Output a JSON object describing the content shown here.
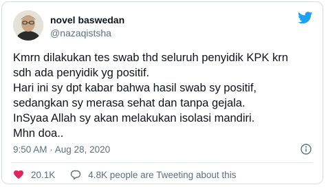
{
  "tweet": {
    "display_name": "novel baswedan",
    "handle": "@nazaqistsha",
    "lines": [
      "Kmrn dilakukan tes swab thd seluruh penyidik KPK krn",
      "sdh ada penyidik yg positif.",
      "Hari ini sy dpt kabar bahwa hasil swab sy positif,",
      "sedangkan sy merasa sehat dan tanpa gejala.",
      "InSyaa Allah sy akan melakukan isolasi mandiri.",
      "Mhn doa.."
    ],
    "timestamp": "9:50 AM · Aug 28, 2020"
  },
  "actions": {
    "like_count": "20.1K",
    "reply_summary": "4.8K people are Tweeting about this"
  },
  "icons": {
    "brand": "twitter-bird-icon",
    "info": "info-icon",
    "like": "heart-icon",
    "reply": "speech-bubble-icon"
  },
  "colors": {
    "brand_blue": "#1da1f2",
    "text_primary": "#0f1419",
    "text_secondary": "#5b7083",
    "like_red": "#e0245e"
  }
}
